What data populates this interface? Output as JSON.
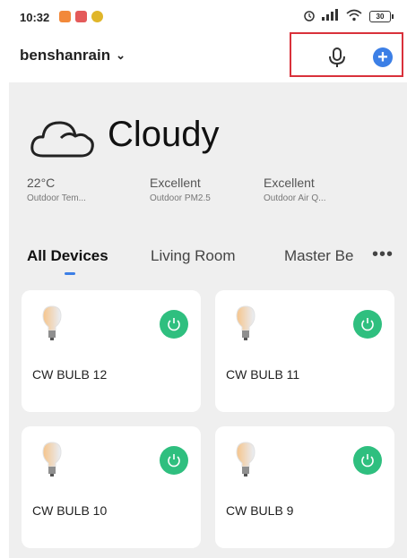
{
  "status_bar": {
    "time": "10:32",
    "battery": "30",
    "app_icon_colors": [
      "#f2893a",
      "#e45a5a",
      "#e0b62a"
    ]
  },
  "header": {
    "account_name": "benshanrain",
    "mic_icon": "microphone-icon",
    "add_icon": "plus-circle-icon",
    "accent_color": "#3c7fe6",
    "highlight_color": "#d9313b"
  },
  "weather": {
    "condition": "Cloudy",
    "icon": "cloud-icon",
    "metrics": [
      {
        "value": "22°C",
        "label": "Outdoor Tem..."
      },
      {
        "value": "Excellent",
        "label": "Outdoor PM2.5"
      },
      {
        "value": "Excellent",
        "label": "Outdoor Air Q..."
      }
    ]
  },
  "tabs": {
    "items": [
      "All Devices",
      "Living Room",
      "Master Be"
    ],
    "active": "All Devices",
    "more": "•••"
  },
  "devices": [
    {
      "name": "CW BULB 12",
      "power_color": "#2fbf7f"
    },
    {
      "name": "CW BULB 11",
      "power_color": "#2fbf7f"
    },
    {
      "name": "CW BULB 10",
      "power_color": "#2fbf7f"
    },
    {
      "name": "CW BULB 9",
      "power_color": "#2fbf7f"
    }
  ]
}
